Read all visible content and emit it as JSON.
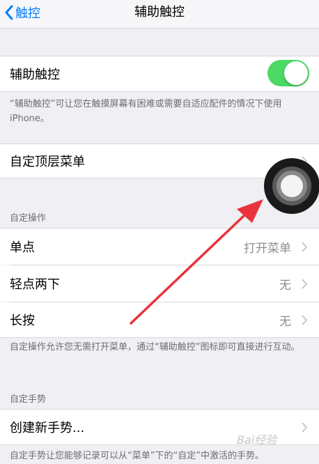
{
  "nav": {
    "back_label": "触控",
    "title": "辅助触控"
  },
  "assistive_touch": {
    "label": "辅助触控",
    "enabled": true,
    "description": "“辅助触控”可让您在触摸屏幕有困难或需要自适应配件的情况下使用iPhone。"
  },
  "top_menu": {
    "label": "自定顶层菜单"
  },
  "custom_actions": {
    "header": "自定操作",
    "rows": [
      {
        "label": "单点",
        "value": "打开菜单"
      },
      {
        "label": "轻点两下",
        "value": "无"
      },
      {
        "label": "长按",
        "value": "无"
      }
    ],
    "footer": "自定操作允许您无需打开菜单，通过“辅助触控”图标即可直接进行互动。"
  },
  "custom_gestures": {
    "header": "自定手势",
    "create_label": "创建新手势...",
    "footer": "自定手势让您能够记录可以从“菜单”下的“自定”中激活的手势。"
  },
  "watermark": "Bai经验",
  "colors": {
    "accent": "#007aff",
    "toggle_on": "#4cd964",
    "arrow": "#e8333a"
  },
  "icons": [
    "chevron-left-icon",
    "chevron-right-icon",
    "assistive-touch-icon",
    "arrow-icon"
  ]
}
